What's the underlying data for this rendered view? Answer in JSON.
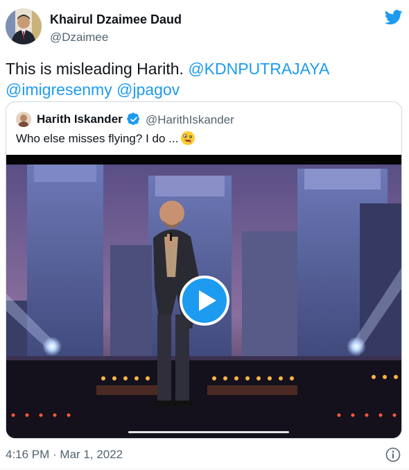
{
  "tweet": {
    "author_name": "Khairul Dzaimee Daud",
    "author_handle": "@Dzaimee",
    "text_prefix": "This is misleading Harith. ",
    "mentions": [
      "@KDNPUTRAJAYA",
      "@imigresenmy",
      "@jpagov"
    ],
    "timestamp": "4:16 PM · Mar 1, 2022"
  },
  "quoted_tweet": {
    "author_name": "Harith Iskander",
    "author_handle": "@HarithIskander",
    "text": "Who else misses flying? I do ...",
    "emoji_icon": "zany-face-icon",
    "verified": true,
    "media": {
      "type": "video",
      "progress": 0.0
    }
  },
  "icons": {
    "brand": "twitter-bird-icon",
    "play": "play-icon",
    "info": "info-icon",
    "verified": "verified-badge-icon"
  },
  "colors": {
    "accent": "#1d9bf0",
    "text": "#0f1419",
    "secondary": "#536471",
    "border": "#cfd9de"
  }
}
